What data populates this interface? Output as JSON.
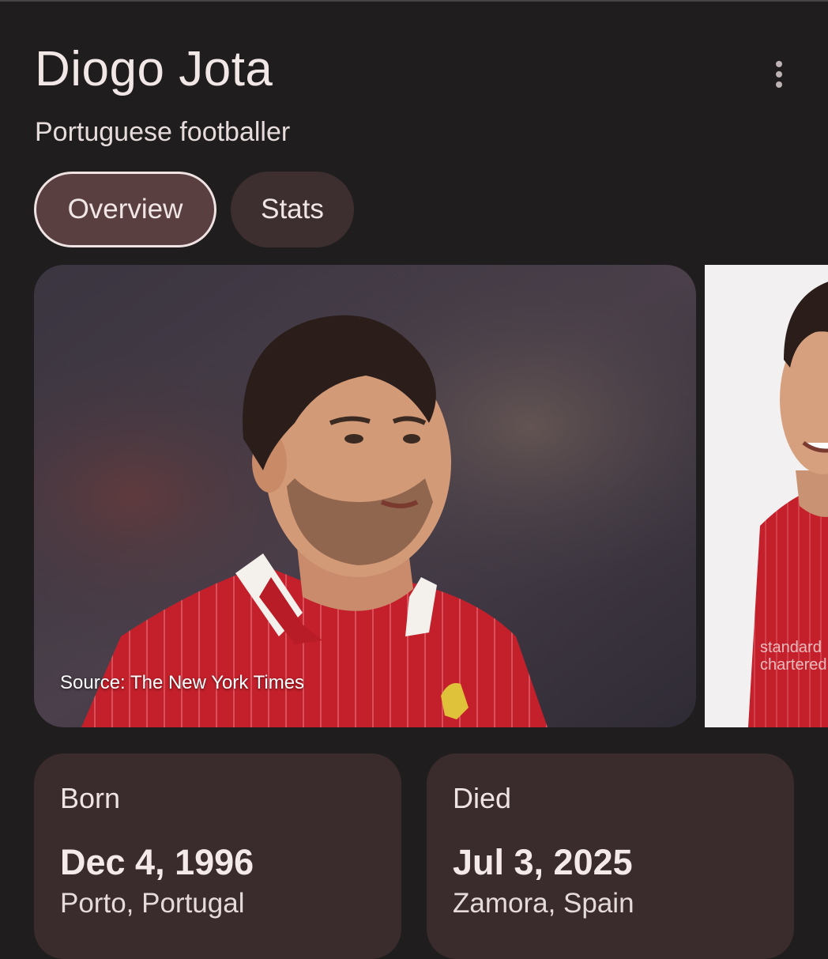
{
  "entity": {
    "title": "Diogo Jota",
    "subtitle": "Portuguese footballer"
  },
  "more_options_icon": "more-vert-icon",
  "tabs": [
    {
      "label": "Overview",
      "selected": true
    },
    {
      "label": "Stats",
      "selected": false
    }
  ],
  "images": {
    "main_caption": "Source: The New York Times"
  },
  "facts": {
    "born": {
      "label": "Born",
      "date": "Dec 4, 1996",
      "place": "Porto, Portugal"
    },
    "died": {
      "label": "Died",
      "date": "Jul 3, 2025",
      "place": "Zamora, Spain"
    }
  },
  "colors": {
    "background": "#1f1d1d",
    "card": "#3a2b2c",
    "tab_selected": "#5a3f41",
    "tab": "#3d2f30",
    "jersey_red": "#c3202b"
  }
}
